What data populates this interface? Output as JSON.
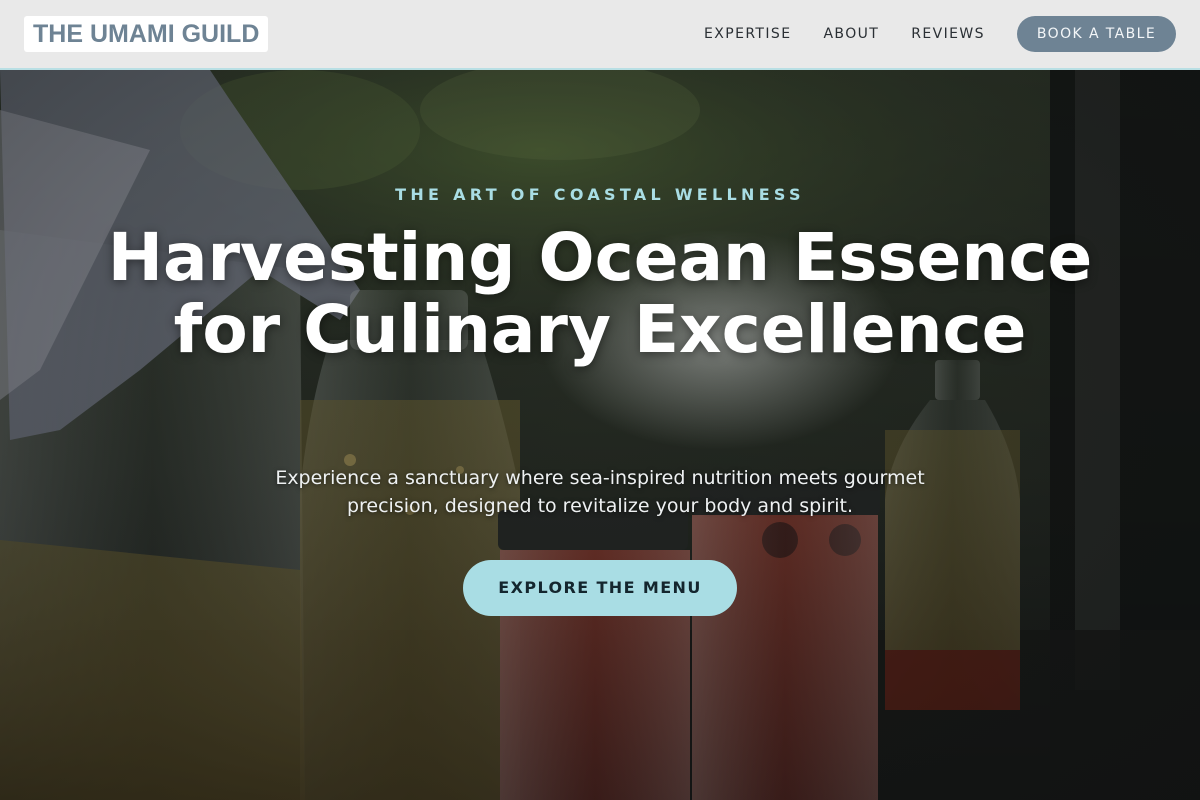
{
  "brand": {
    "logo_text": "THE UMAMI GUILD"
  },
  "nav": {
    "links": [
      "EXPERTISE",
      "ABOUT",
      "REVIEWS"
    ],
    "book_label": "BOOK A TABLE"
  },
  "hero": {
    "eyebrow": "THE ART OF COASTAL WELLNESS",
    "headline": "Harvesting Ocean Essence for Culinary Excellence",
    "subtext": "Experience a sanctuary where sea-inspired nutrition meets gourmet precision, designed to revitalize your body and spirit.",
    "cta_label": "EXPLORE THE MENU",
    "background_image": "jars-and-bottles-photo"
  },
  "colors": {
    "accent": "#a9dde4",
    "brand_slate": "#6e8394",
    "nav_background": "#e9e9e9",
    "headline_text": "#ffffff"
  }
}
